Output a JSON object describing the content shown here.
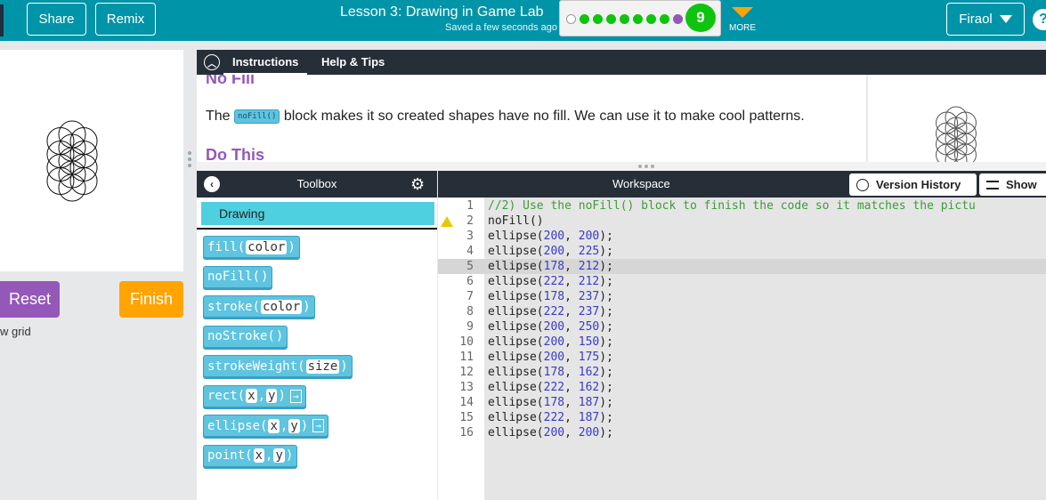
{
  "header": {
    "share_label": "Share",
    "remix_label": "Remix",
    "lesson_title": "Lesson 3: Drawing in Game Lab",
    "saved_status": "Saved a few seconds ago",
    "level_number": "9",
    "more_label": "MORE",
    "user_name": "Firaol",
    "help_label": "?"
  },
  "progress_dots": [
    "#ffffff",
    "#0ec40e",
    "#0ec40e",
    "#0ec40e",
    "#0ec40e",
    "#0ec40e",
    "#0ec40e",
    "#0ec40e",
    "#9358b8"
  ],
  "run_panel": {
    "reset_label": "Reset",
    "finish_label": "Finish",
    "grid_label": "w grid"
  },
  "instructions": {
    "tab_instructions": "Instructions",
    "tab_help": "Help & Tips",
    "heading_no_fill": "No Fill",
    "para_prefix": "The",
    "para_chip": "noFill()",
    "para_suffix": "block makes it so created shapes have no fill. We can use it to make cool patterns.",
    "heading_do_this": "Do This"
  },
  "toolbox": {
    "title": "Toolbox",
    "category": "Drawing",
    "blocks": [
      {
        "name": "fill",
        "args": [
          "color"
        ],
        "arrow": false
      },
      {
        "name": "noFill",
        "args": [],
        "arrow": false
      },
      {
        "name": "stroke",
        "args": [
          "color"
        ],
        "arrow": false
      },
      {
        "name": "noStroke",
        "args": [],
        "arrow": false
      },
      {
        "name": "strokeWeight",
        "args": [
          "size"
        ],
        "arrow": false
      },
      {
        "name": "rect",
        "args": [
          "x",
          "y"
        ],
        "arrow": true
      },
      {
        "name": "ellipse",
        "args": [
          "x",
          "y"
        ],
        "arrow": true
      },
      {
        "name": "point",
        "args": [
          "x",
          "y"
        ],
        "arrow": false
      }
    ]
  },
  "workspace": {
    "title": "Workspace",
    "version_history_label": "Version History",
    "show_label": "Show",
    "code_lines": [
      "//2) Use the noFill() block to finish the code so it matches the pictu",
      "noFill()",
      "ellipse(200, 200);",
      "ellipse(200, 225);",
      "ellipse(178, 212);",
      "ellipse(222, 212);",
      "ellipse(178, 237);",
      "ellipse(222, 237);",
      "ellipse(200, 250);",
      "ellipse(200, 150);",
      "ellipse(200, 175);",
      "ellipse(178, 162);",
      "ellipse(222, 162);",
      "ellipse(178, 187);",
      "ellipse(222, 187);",
      "ellipse(200, 200);"
    ]
  }
}
